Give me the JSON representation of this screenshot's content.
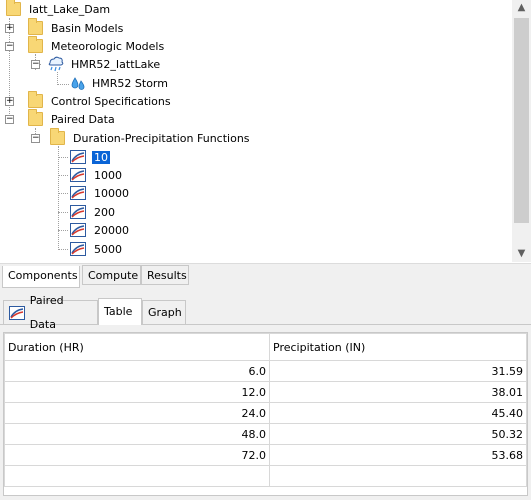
{
  "tree": {
    "root": "Iatt_Lake_Dam",
    "basin_models": "Basin Models",
    "meteorologic_models": "Meteorologic Models",
    "met_model": "HMR52_IattLake",
    "storm": "HMR52 Storm",
    "control_specifications": "Control Specifications",
    "paired_data": "Paired Data",
    "dpf_folder": "Duration-Precipitation Functions",
    "dpf_items": [
      "10",
      "1000",
      "10000",
      "200",
      "20000",
      "5000"
    ],
    "selected_item": "10"
  },
  "bottom_tabs": [
    "Components",
    "Compute",
    "Results"
  ],
  "active_bottom_tab": "Components",
  "panel_tabs": {
    "paired_data": "Paired Data",
    "table": "Table",
    "graph": "Graph",
    "active": "Table"
  },
  "table": {
    "headers": [
      "Duration (HR)",
      "Precipitation (IN)"
    ],
    "rows": [
      [
        "6.0",
        "31.59"
      ],
      [
        "12.0",
        "38.01"
      ],
      [
        "24.0",
        "45.40"
      ],
      [
        "48.0",
        "50.32"
      ],
      [
        "72.0",
        "53.68"
      ],
      [
        "",
        ""
      ]
    ]
  },
  "colors": {
    "selection": "#0a64d6",
    "folder": "#f8d775",
    "icon_blue": "#2d5aa0",
    "icon_red": "#d8382c"
  }
}
